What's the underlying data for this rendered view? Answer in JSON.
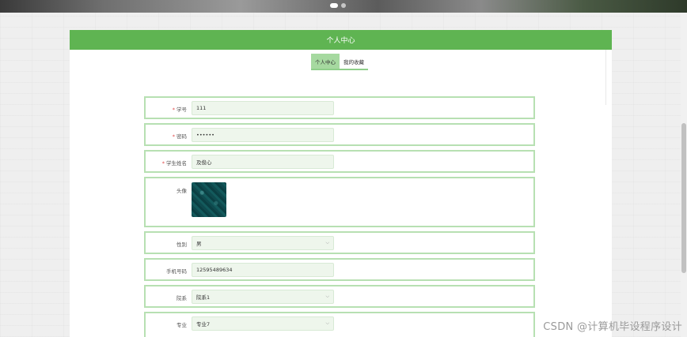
{
  "page": {
    "title": "个人中心"
  },
  "tabs": [
    {
      "label": "个人中心",
      "active": true
    },
    {
      "label": "我的收藏",
      "active": false
    }
  ],
  "form": {
    "student_id": {
      "label": "学号",
      "required": true,
      "value": "111"
    },
    "password": {
      "label": "密码",
      "required": true,
      "value": "••••••"
    },
    "student_name": {
      "label": "学生姓名",
      "required": true,
      "value": "及俊心"
    },
    "avatar": {
      "label": "头像"
    },
    "gender": {
      "label": "性别",
      "value": "男"
    },
    "phone": {
      "label": "手机号码",
      "value": "12595489634"
    },
    "department": {
      "label": "院系",
      "value": "院系1"
    },
    "major": {
      "label": "专业",
      "value": "专业7"
    }
  },
  "watermark": "CSDN @计算机毕设程序设计",
  "colors": {
    "header": "#5fb452",
    "tab_active": "#a6d9a0",
    "row_border": "#b7e0b2",
    "required": "#e04848"
  },
  "icons": {
    "select": "chevron-down-icon"
  }
}
